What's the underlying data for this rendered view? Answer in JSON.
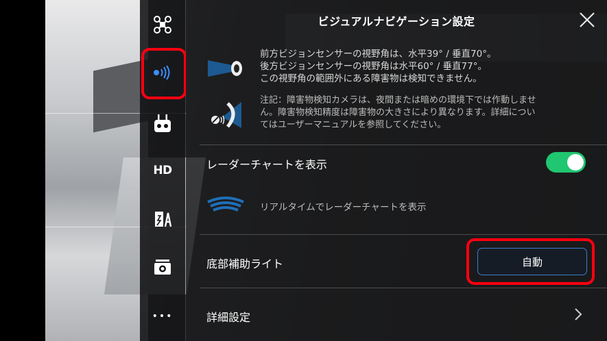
{
  "header": {
    "title": "ビジュアルナビゲーション設定"
  },
  "sidebar": {
    "items": [
      {
        "icon": "drone-icon"
      },
      {
        "icon": "radar-icon",
        "active": true
      },
      {
        "icon": "remote-controller-icon"
      },
      {
        "label": "HD",
        "icon": "hd-icon"
      },
      {
        "icon": "battery-icon"
      },
      {
        "icon": "camera-icon"
      },
      {
        "label": "•••",
        "icon": "more-icon"
      }
    ]
  },
  "sensor_info": {
    "line1": "前方ビジョンセンサーの視野角は、水平39° / 垂直70°。",
    "line2": "後方ビジョンセンサーの視野角は水平60° / 垂直77°。",
    "line3": "この視野角の範囲外にある障害物は検知できません。",
    "note_line1": "注記：障害物検知カメラは、夜間または暗めの環境下では作動しませ",
    "note_line2": "ん。障害物検知精度は障害物の大きさにより異なります。詳細につい",
    "note_line3": "てはユーザーマニュアルを参照してください。"
  },
  "radar_chart": {
    "label": "レーダーチャートを表示",
    "enabled": true,
    "description": "リアルタイムでレーダーチャートを表示"
  },
  "bottom_light": {
    "label": "底部補助ライト",
    "value": "自動"
  },
  "advanced": {
    "label": "詳細設定"
  },
  "colors": {
    "toggle_on": "#20c670",
    "button_border": "#3b7ccc",
    "highlight": "#ff0010"
  }
}
